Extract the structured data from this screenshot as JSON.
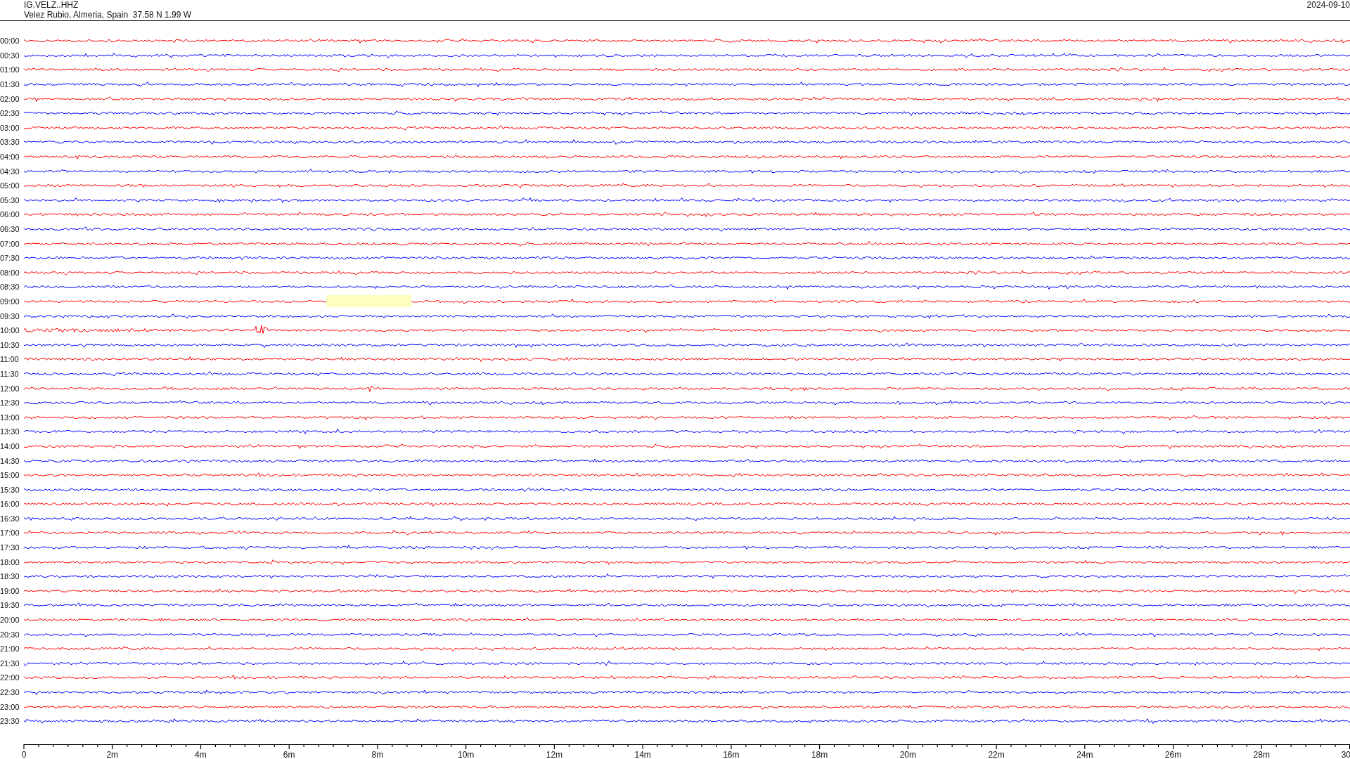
{
  "header": {
    "station": "IG.VELZ..HHZ",
    "location": "Velez Rubio, Almeria, Spain  37.58 N 1.99 W",
    "date": "2024-09-10"
  },
  "traces": [
    {
      "label": "00:00",
      "color": "#ff0000"
    },
    {
      "label": "00:30",
      "color": "#0000ff"
    },
    {
      "label": "01:00",
      "color": "#ff0000"
    },
    {
      "label": "01:30",
      "color": "#0000ff"
    },
    {
      "label": "02:00",
      "color": "#ff0000"
    },
    {
      "label": "02:30",
      "color": "#0000ff"
    },
    {
      "label": "03:00",
      "color": "#ff0000"
    },
    {
      "label": "03:30",
      "color": "#0000ff"
    },
    {
      "label": "04:00",
      "color": "#ff0000"
    },
    {
      "label": "04:30",
      "color": "#0000ff"
    },
    {
      "label": "05:00",
      "color": "#ff0000"
    },
    {
      "label": "05:30",
      "color": "#0000ff"
    },
    {
      "label": "06:00",
      "color": "#ff0000"
    },
    {
      "label": "06:30",
      "color": "#0000ff"
    },
    {
      "label": "07:00",
      "color": "#ff0000"
    },
    {
      "label": "07:30",
      "color": "#0000ff"
    },
    {
      "label": "08:00",
      "color": "#ff0000"
    },
    {
      "label": "08:30",
      "color": "#0000ff"
    },
    {
      "label": "09:00",
      "color": "#ff0000",
      "gap": true
    },
    {
      "label": "09:30",
      "color": "#0000ff"
    },
    {
      "label": "10:00",
      "color": "#ff0000",
      "event": true
    },
    {
      "label": "10:30",
      "color": "#0000ff"
    },
    {
      "label": "11:00",
      "color": "#ff0000"
    },
    {
      "label": "11:30",
      "color": "#0000ff"
    },
    {
      "label": "12:00",
      "color": "#ff0000",
      "event": true
    },
    {
      "label": "12:30",
      "color": "#0000ff"
    },
    {
      "label": "13:00",
      "color": "#ff0000"
    },
    {
      "label": "13:30",
      "color": "#0000ff"
    },
    {
      "label": "14:00",
      "color": "#ff0000"
    },
    {
      "label": "14:30",
      "color": "#0000ff"
    },
    {
      "label": "15:00",
      "color": "#ff0000"
    },
    {
      "label": "15:30",
      "color": "#0000ff"
    },
    {
      "label": "16:00",
      "color": "#ff0000"
    },
    {
      "label": "16:30",
      "color": "#0000ff"
    },
    {
      "label": "17:00",
      "color": "#ff0000"
    },
    {
      "label": "17:30",
      "color": "#0000ff"
    },
    {
      "label": "18:00",
      "color": "#ff0000"
    },
    {
      "label": "18:30",
      "color": "#0000ff"
    },
    {
      "label": "19:00",
      "color": "#ff0000"
    },
    {
      "label": "19:30",
      "color": "#0000ff"
    },
    {
      "label": "20:00",
      "color": "#ff0000"
    },
    {
      "label": "20:30",
      "color": "#0000ff"
    },
    {
      "label": "21:00",
      "color": "#ff0000"
    },
    {
      "label": "21:30",
      "color": "#0000ff"
    },
    {
      "label": "22:00",
      "color": "#ff0000"
    },
    {
      "label": "22:30",
      "color": "#0000ff"
    },
    {
      "label": "23:00",
      "color": "#ff0000"
    },
    {
      "label": "23:30",
      "color": "#0000ff"
    }
  ],
  "x_axis": {
    "labels": [
      "0",
      "2m",
      "4m",
      "6m",
      "8m",
      "10m",
      "12m",
      "14m",
      "16m",
      "18m",
      "20m",
      "22m",
      "24m",
      "26m",
      "28m",
      "30"
    ]
  }
}
